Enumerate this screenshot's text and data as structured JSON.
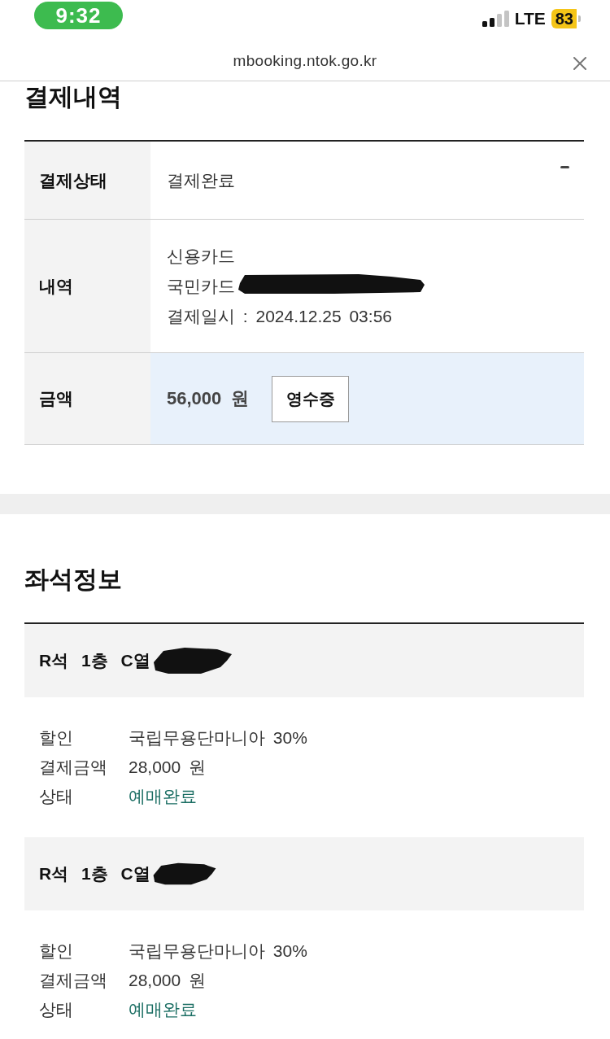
{
  "status_bar": {
    "time": "9:32",
    "network": "LTE",
    "battery": "83"
  },
  "address_bar": {
    "url": "mbooking.ntok.go.kr"
  },
  "payment": {
    "title": "결제내역",
    "rows": [
      {
        "kind": "text",
        "label": "결제상태",
        "value": "결제완료",
        "highlighted": false,
        "stray_mark": true
      },
      {
        "kind": "lines",
        "label": "내역",
        "highlighted": false,
        "lines": [
          {
            "text": "신용카드",
            "redacted": false
          },
          {
            "text": "국민카드",
            "redacted": true
          },
          {
            "text": "결제일시 : 2024.12.25 03:56",
            "redacted": false
          }
        ]
      },
      {
        "kind": "amount",
        "label": "금액",
        "value": "56,000 원",
        "button": "영수증",
        "highlighted": true
      }
    ]
  },
  "seats": {
    "title": "좌석정보",
    "items": [
      {
        "header": "R석 1층 C열",
        "redacted": true,
        "details": [
          {
            "kind": "text",
            "label": "할인",
            "value": "국립무용단마니아 30%"
          },
          {
            "kind": "text",
            "label": "결제금액",
            "value": "28,000 원"
          },
          {
            "kind": "status",
            "label": "상태",
            "value": "예매완료"
          }
        ]
      },
      {
        "header": "R석 1층 C열",
        "redacted": true,
        "details": [
          {
            "kind": "text",
            "label": "할인",
            "value": "국립무용단마니아 30%"
          },
          {
            "kind": "text",
            "label": "결제금액",
            "value": "28,000 원"
          },
          {
            "kind": "status",
            "label": "상태",
            "value": "예매완료"
          }
        ]
      }
    ]
  }
}
